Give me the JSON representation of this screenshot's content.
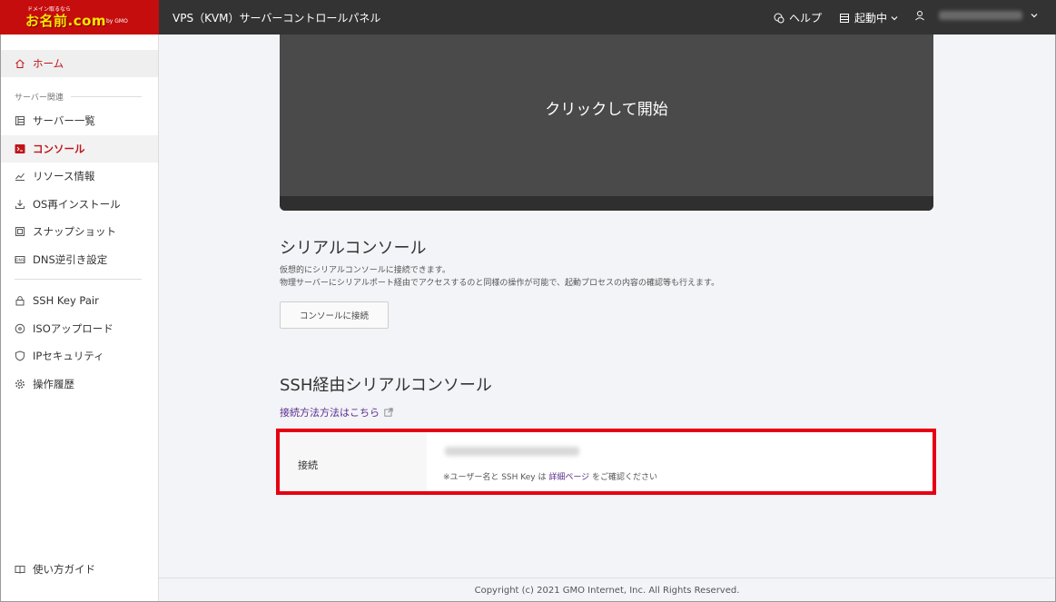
{
  "header": {
    "logo": {
      "tagline": "ドメイン取るなら",
      "brand": "お名前.com",
      "company": "by GMO"
    },
    "title": "VPS（KVM）サーバーコントロールパネル",
    "help_label": "ヘルプ",
    "status_label": "起動中",
    "user_label": ""
  },
  "sidebar": {
    "home": "ホーム",
    "section_label": "サーバー関連",
    "items": [
      {
        "label": "サーバー一覧"
      },
      {
        "label": "コンソール"
      },
      {
        "label": "リソース情報"
      },
      {
        "label": "OS再インストール"
      },
      {
        "label": "スナップショット"
      },
      {
        "label": "DNS逆引き設定"
      },
      {
        "label": "SSH Key Pair"
      },
      {
        "label": "ISOアップロード"
      },
      {
        "label": "IPセキュリティ"
      },
      {
        "label": "操作履歴"
      }
    ],
    "guide": "使い方ガイド"
  },
  "main": {
    "console_start": "クリックして開始",
    "serial": {
      "heading": "シリアルコンソール",
      "desc_line1": "仮想的にシリアルコンソールに接続できます。",
      "desc_line2": "物理サーバーにシリアルポート経由でアクセスするのと同様の操作が可能で、起動プロセスの内容の確認等も行えます。",
      "button": "コンソールに接続"
    },
    "ssh": {
      "heading": "SSH経由シリアルコンソール",
      "howto_link": "接続方法方法はこちら",
      "connection_label": "接続",
      "note_prefix": "※ユーザー名と SSH Key は",
      "note_link": "詳細ページ",
      "note_suffix": "をご確認ください"
    }
  },
  "footer": {
    "copyright": "Copyright (c) 2021 GMO Internet, Inc. All Rights Reserved."
  },
  "colors": {
    "accent": "#c0151a",
    "highlight": "#e60012",
    "header_bg": "#333334",
    "link": "#5b2d8e"
  }
}
